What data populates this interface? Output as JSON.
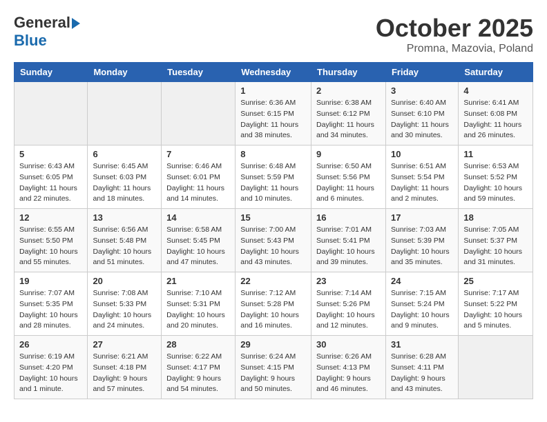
{
  "logo": {
    "general": "General",
    "blue": "Blue"
  },
  "title": "October 2025",
  "location": "Promna, Mazovia, Poland",
  "weekdays": [
    "Sunday",
    "Monday",
    "Tuesday",
    "Wednesday",
    "Thursday",
    "Friday",
    "Saturday"
  ],
  "weeks": [
    [
      {
        "day": "",
        "info": ""
      },
      {
        "day": "",
        "info": ""
      },
      {
        "day": "",
        "info": ""
      },
      {
        "day": "1",
        "info": "Sunrise: 6:36 AM\nSunset: 6:15 PM\nDaylight: 11 hours\nand 38 minutes."
      },
      {
        "day": "2",
        "info": "Sunrise: 6:38 AM\nSunset: 6:12 PM\nDaylight: 11 hours\nand 34 minutes."
      },
      {
        "day": "3",
        "info": "Sunrise: 6:40 AM\nSunset: 6:10 PM\nDaylight: 11 hours\nand 30 minutes."
      },
      {
        "day": "4",
        "info": "Sunrise: 6:41 AM\nSunset: 6:08 PM\nDaylight: 11 hours\nand 26 minutes."
      }
    ],
    [
      {
        "day": "5",
        "info": "Sunrise: 6:43 AM\nSunset: 6:05 PM\nDaylight: 11 hours\nand 22 minutes."
      },
      {
        "day": "6",
        "info": "Sunrise: 6:45 AM\nSunset: 6:03 PM\nDaylight: 11 hours\nand 18 minutes."
      },
      {
        "day": "7",
        "info": "Sunrise: 6:46 AM\nSunset: 6:01 PM\nDaylight: 11 hours\nand 14 minutes."
      },
      {
        "day": "8",
        "info": "Sunrise: 6:48 AM\nSunset: 5:59 PM\nDaylight: 11 hours\nand 10 minutes."
      },
      {
        "day": "9",
        "info": "Sunrise: 6:50 AM\nSunset: 5:56 PM\nDaylight: 11 hours\nand 6 minutes."
      },
      {
        "day": "10",
        "info": "Sunrise: 6:51 AM\nSunset: 5:54 PM\nDaylight: 11 hours\nand 2 minutes."
      },
      {
        "day": "11",
        "info": "Sunrise: 6:53 AM\nSunset: 5:52 PM\nDaylight: 10 hours\nand 59 minutes."
      }
    ],
    [
      {
        "day": "12",
        "info": "Sunrise: 6:55 AM\nSunset: 5:50 PM\nDaylight: 10 hours\nand 55 minutes."
      },
      {
        "day": "13",
        "info": "Sunrise: 6:56 AM\nSunset: 5:48 PM\nDaylight: 10 hours\nand 51 minutes."
      },
      {
        "day": "14",
        "info": "Sunrise: 6:58 AM\nSunset: 5:45 PM\nDaylight: 10 hours\nand 47 minutes."
      },
      {
        "day": "15",
        "info": "Sunrise: 7:00 AM\nSunset: 5:43 PM\nDaylight: 10 hours\nand 43 minutes."
      },
      {
        "day": "16",
        "info": "Sunrise: 7:01 AM\nSunset: 5:41 PM\nDaylight: 10 hours\nand 39 minutes."
      },
      {
        "day": "17",
        "info": "Sunrise: 7:03 AM\nSunset: 5:39 PM\nDaylight: 10 hours\nand 35 minutes."
      },
      {
        "day": "18",
        "info": "Sunrise: 7:05 AM\nSunset: 5:37 PM\nDaylight: 10 hours\nand 31 minutes."
      }
    ],
    [
      {
        "day": "19",
        "info": "Sunrise: 7:07 AM\nSunset: 5:35 PM\nDaylight: 10 hours\nand 28 minutes."
      },
      {
        "day": "20",
        "info": "Sunrise: 7:08 AM\nSunset: 5:33 PM\nDaylight: 10 hours\nand 24 minutes."
      },
      {
        "day": "21",
        "info": "Sunrise: 7:10 AM\nSunset: 5:31 PM\nDaylight: 10 hours\nand 20 minutes."
      },
      {
        "day": "22",
        "info": "Sunrise: 7:12 AM\nSunset: 5:28 PM\nDaylight: 10 hours\nand 16 minutes."
      },
      {
        "day": "23",
        "info": "Sunrise: 7:14 AM\nSunset: 5:26 PM\nDaylight: 10 hours\nand 12 minutes."
      },
      {
        "day": "24",
        "info": "Sunrise: 7:15 AM\nSunset: 5:24 PM\nDaylight: 10 hours\nand 9 minutes."
      },
      {
        "day": "25",
        "info": "Sunrise: 7:17 AM\nSunset: 5:22 PM\nDaylight: 10 hours\nand 5 minutes."
      }
    ],
    [
      {
        "day": "26",
        "info": "Sunrise: 6:19 AM\nSunset: 4:20 PM\nDaylight: 10 hours\nand 1 minute."
      },
      {
        "day": "27",
        "info": "Sunrise: 6:21 AM\nSunset: 4:18 PM\nDaylight: 9 hours\nand 57 minutes."
      },
      {
        "day": "28",
        "info": "Sunrise: 6:22 AM\nSunset: 4:17 PM\nDaylight: 9 hours\nand 54 minutes."
      },
      {
        "day": "29",
        "info": "Sunrise: 6:24 AM\nSunset: 4:15 PM\nDaylight: 9 hours\nand 50 minutes."
      },
      {
        "day": "30",
        "info": "Sunrise: 6:26 AM\nSunset: 4:13 PM\nDaylight: 9 hours\nand 46 minutes."
      },
      {
        "day": "31",
        "info": "Sunrise: 6:28 AM\nSunset: 4:11 PM\nDaylight: 9 hours\nand 43 minutes."
      },
      {
        "day": "",
        "info": ""
      }
    ]
  ]
}
